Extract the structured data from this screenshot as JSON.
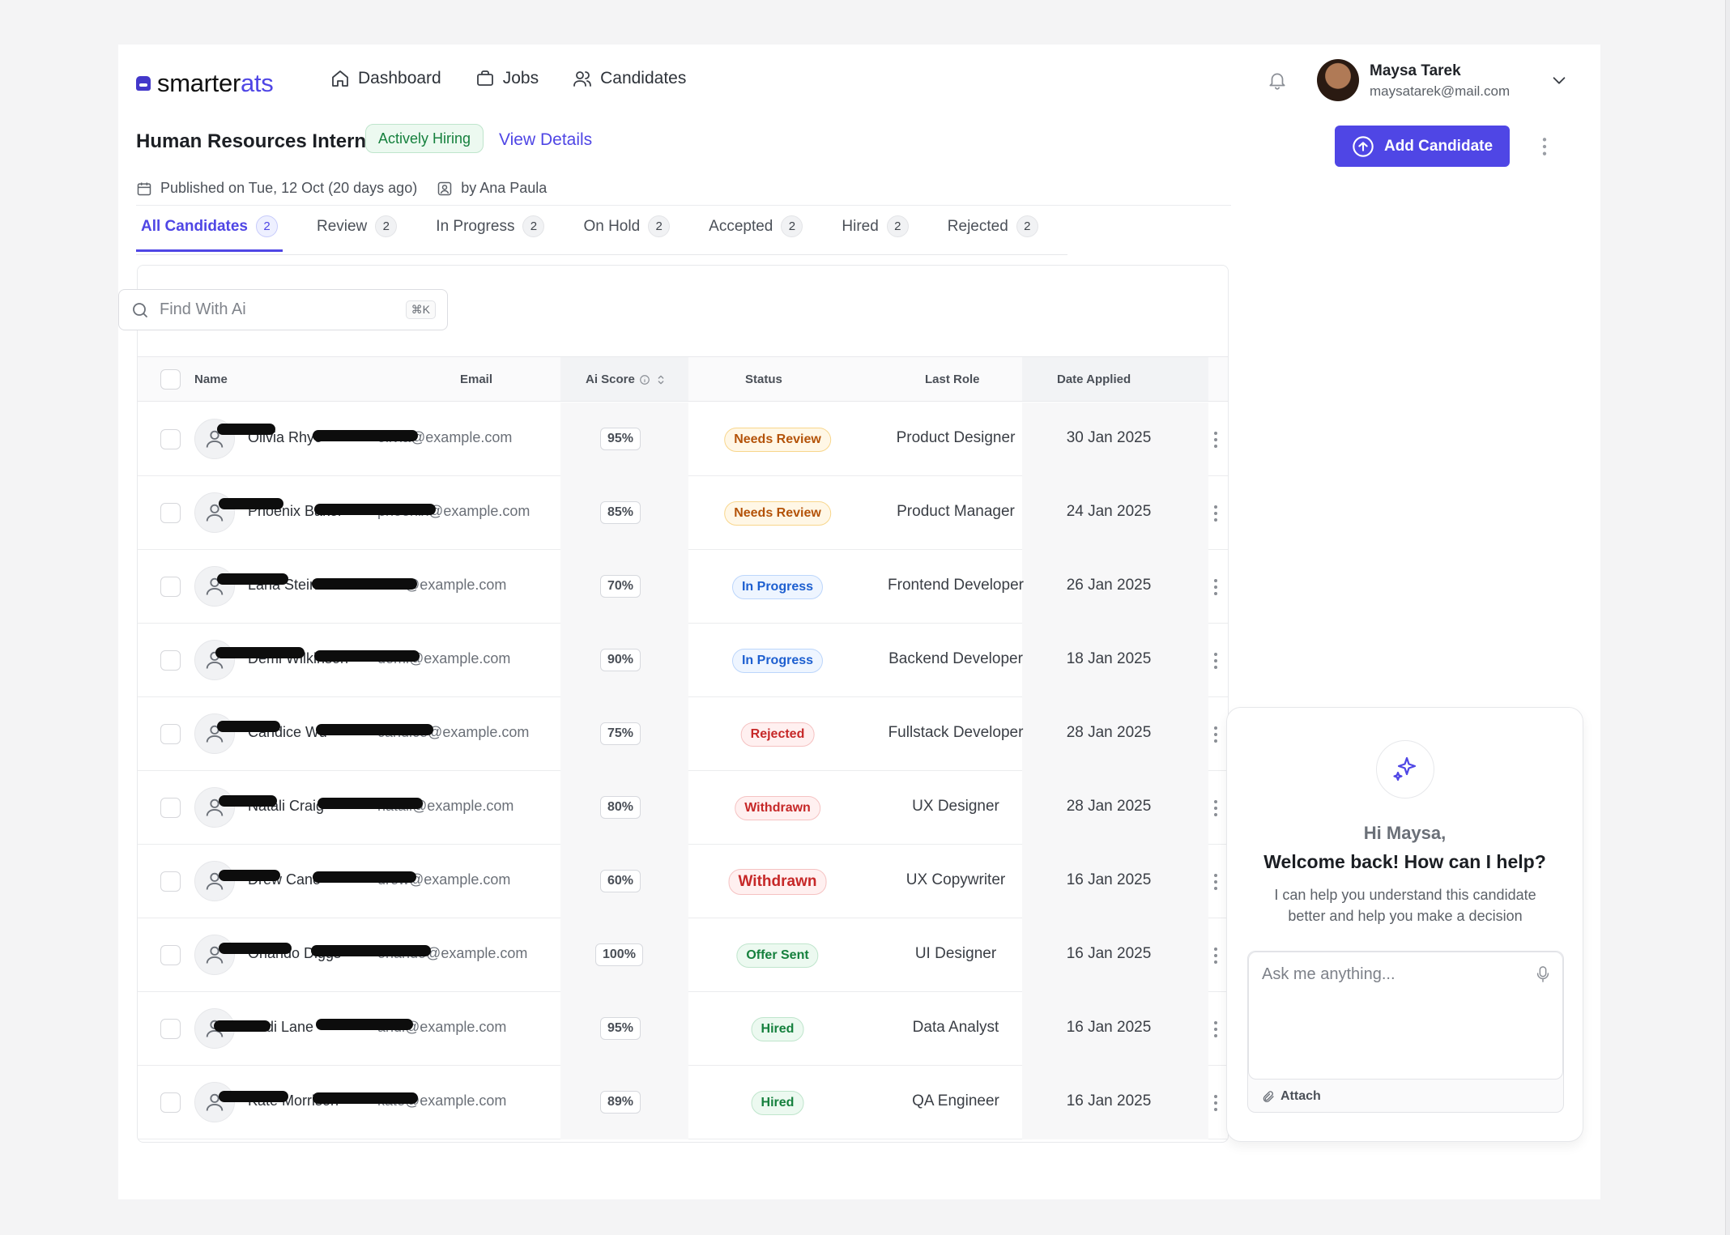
{
  "brand": {
    "part1": "smarter",
    "part2": "ats"
  },
  "nav": [
    {
      "label": "Dashboard",
      "icon": "home-icon"
    },
    {
      "label": "Jobs",
      "icon": "briefcase-icon"
    },
    {
      "label": "Candidates",
      "icon": "users-icon"
    }
  ],
  "user": {
    "name": "Maysa Tarek",
    "email": "maysatarek@mail.com"
  },
  "job": {
    "title": "Human Resources Intern",
    "status_badge": "Actively Hiring",
    "view_details": "View Details",
    "published": "Published on Tue, 12 Oct (20 days ago)",
    "by": "by Ana Paula"
  },
  "actions": {
    "add_candidate": "Add Candidate"
  },
  "tabs": [
    {
      "label": "All Candidates",
      "count": "2",
      "active": true
    },
    {
      "label": "Review",
      "count": "2"
    },
    {
      "label": "In Progress",
      "count": "2"
    },
    {
      "label": "On Hold",
      "count": "2"
    },
    {
      "label": "Accepted",
      "count": "2"
    },
    {
      "label": "Hired",
      "count": "2"
    },
    {
      "label": "Rejected",
      "count": "2"
    }
  ],
  "search": {
    "placeholder": "Find With Ai",
    "shortcut": "⌘K"
  },
  "table": {
    "headers": {
      "name": "Name",
      "email": "Email",
      "score": "Ai Score",
      "status": "Status",
      "role": "Last Role",
      "date": "Date Applied"
    },
    "rows": [
      {
        "name": "Olivia Rhye",
        "email": "olivia@example.com",
        "score": "95%",
        "status": "Needs Review",
        "status_kind": "review",
        "role": "Product Designer",
        "date": "30 Jan 2025"
      },
      {
        "name": "Phoenix Baker",
        "email": "phoenix@example.com",
        "score": "85%",
        "status": "Needs Review",
        "status_kind": "review",
        "role": "Product Manager",
        "date": "24 Jan 2025"
      },
      {
        "name": "Lana Steiner",
        "email": "lana@example.com",
        "score": "70%",
        "status": "In Progress",
        "status_kind": "progress",
        "role": "Frontend Developer",
        "date": "26 Jan 2025"
      },
      {
        "name": "Demi Wilkinson",
        "email": "demi@example.com",
        "score": "90%",
        "status": "In Progress",
        "status_kind": "progress",
        "role": "Backend Developer",
        "date": "18 Jan 2025"
      },
      {
        "name": "Candice Wu",
        "email": "candice@example.com",
        "score": "75%",
        "status": "Rejected",
        "status_kind": "rejected",
        "role": "Fullstack Developer",
        "date": "28 Jan 2025"
      },
      {
        "name": "Natali Craig",
        "email": "natali@example.com",
        "score": "80%",
        "status": "Withdrawn",
        "status_kind": "withdrawn",
        "role": "UX Designer",
        "date": "28 Jan 2025"
      },
      {
        "name": "Drew Cano",
        "email": "drew@example.com",
        "score": "60%",
        "status": "Withdrawn",
        "status_kind": "withdrawn-lg",
        "role": "UX Copywriter",
        "date": "16 Jan 2025"
      },
      {
        "name": "Orlando Diggs",
        "email": "orlando@example.com",
        "score": "100%",
        "status": "Offer Sent",
        "status_kind": "offer",
        "role": "UI Designer",
        "date": "16 Jan 2025"
      },
      {
        "name": "Andi Lane",
        "email": "andi@example.com",
        "score": "95%",
        "status": "Hired",
        "status_kind": "hired",
        "role": "Data Analyst",
        "date": "16 Jan 2025"
      },
      {
        "name": "Kate Morrison",
        "email": "kate@example.com",
        "score": "89%",
        "status": "Hired",
        "status_kind": "hired",
        "role": "QA Engineer",
        "date": "16 Jan 2025"
      }
    ]
  },
  "ai": {
    "greeting": "Hi Maysa,",
    "welcome": "Welcome back! How can I help?",
    "description": "I can help you understand this candidate better and help you make a decision",
    "placeholder": "Ask me anything...",
    "attach": "Attach"
  },
  "colors": {
    "accent": "#4f46e5",
    "success": "#15803d",
    "warning": "#b45309",
    "info": "#1d5fd0",
    "danger": "#c62828"
  }
}
